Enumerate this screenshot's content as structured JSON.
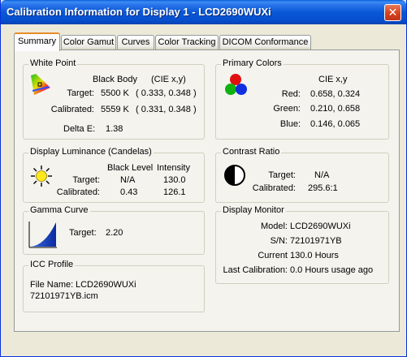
{
  "window": {
    "title": "Calibration Information for Display 1 - LCD2690WUXi",
    "close_glyph": "✕"
  },
  "tabs": [
    {
      "label": "Summary"
    },
    {
      "label": "Color Gamut"
    },
    {
      "label": "Curves"
    },
    {
      "label": "Color Tracking"
    },
    {
      "label": "DICOM Conformance"
    }
  ],
  "white_point": {
    "title": "White Point",
    "col_black_body": "Black Body",
    "col_cie": "(CIE x,y)",
    "target_label": "Target:",
    "target_kelvin": "5500 K",
    "target_xy": "( 0.333, 0.348 )",
    "calibrated_label": "Calibrated:",
    "calibrated_kelvin": "5559 K",
    "calibrated_xy": "( 0.331, 0.348 )",
    "delta_label": "Delta E:",
    "delta_value": "1.38"
  },
  "primary_colors": {
    "title": "Primary Colors",
    "col_cie": "CIE x,y",
    "red_label": "Red:",
    "red_value": "0.658, 0.324",
    "green_label": "Green:",
    "green_value": "0.210, 0.658",
    "blue_label": "Blue:",
    "blue_value": "0.146, 0.065"
  },
  "luminance": {
    "title": "Display Luminance (Candelas)",
    "col_black": "Black Level",
    "col_intensity": "Intensity",
    "target_label": "Target:",
    "target_black": "N/A",
    "target_intensity": "130.0",
    "calibrated_label": "Calibrated:",
    "calibrated_black": "0.43",
    "calibrated_intensity": "126.1"
  },
  "contrast": {
    "title": "Contrast Ratio",
    "target_label": "Target:",
    "target_value": "N/A",
    "calibrated_label": "Calibrated:",
    "calibrated_value": "295.6:1"
  },
  "gamma": {
    "title": "Gamma Curve",
    "target_label": "Target:",
    "target_value": "2.20"
  },
  "monitor": {
    "title": "Display Monitor",
    "model_label": "Model:",
    "model_value": "LCD2690WUXi",
    "sn_label": "S/N:",
    "sn_value": "72101971YB",
    "current_label": "Current",
    "current_value": "130.0 Hours",
    "lastcal_label": "Last Calibration:",
    "lastcal_value": "0.0 Hours usage ago"
  },
  "icc": {
    "title": "ICC Profile",
    "file_label": "File Name:",
    "file_value": "LCD2690WUXi",
    "file_value2": "72101971YB.icm"
  },
  "colors": {
    "title_bar": "#0a58d6",
    "window_bg": "#ece9d8",
    "panel_bg": "#f4f3ee",
    "active_tab_accent": "#e68b2c"
  }
}
